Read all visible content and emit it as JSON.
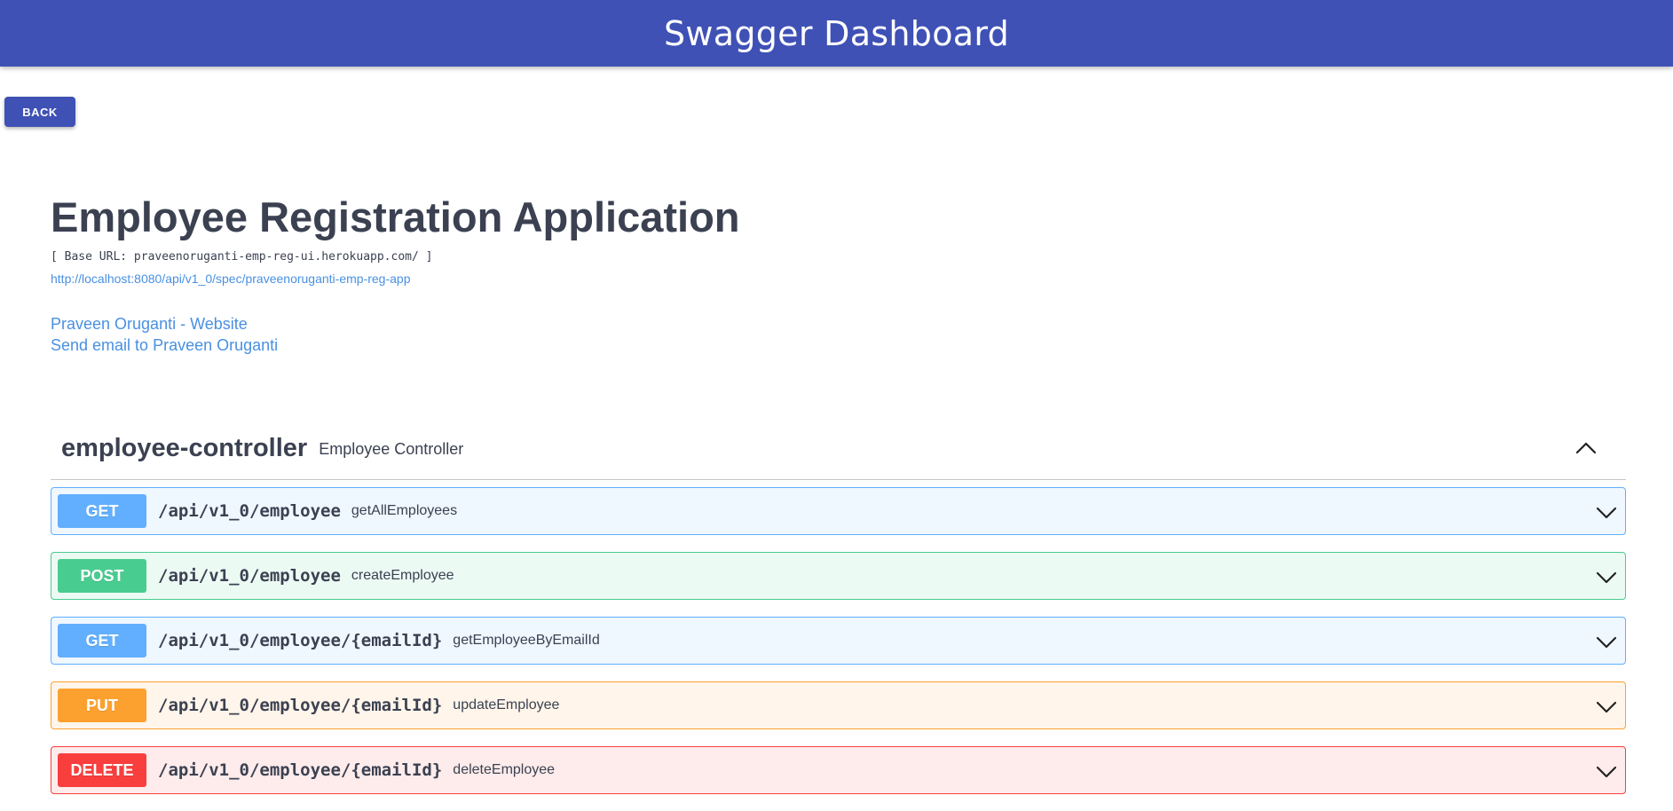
{
  "header": {
    "title": "Swagger Dashboard"
  },
  "back_button": {
    "label": "BACK"
  },
  "info": {
    "title": "Employee Registration Application",
    "base_url": "[ Base URL: praveenoruganti-emp-reg-ui.herokuapp.com/ ]",
    "spec_link": "http://localhost:8080/api/v1_0/spec/praveenoruganti-emp-reg-app",
    "website_link": "Praveen Oruganti - Website",
    "email_link": "Send email to Praveen Oruganti"
  },
  "tag": {
    "name": "employee-controller",
    "description": "Employee Controller",
    "toggle_icon": "chevron-up-icon"
  },
  "operations": [
    {
      "method": "GET",
      "path": "/api/v1_0/employee",
      "summary": "getAllEmployees",
      "color": "#61affe"
    },
    {
      "method": "POST",
      "path": "/api/v1_0/employee",
      "summary": "createEmployee",
      "color": "#49cc90"
    },
    {
      "method": "GET",
      "path": "/api/v1_0/employee/{emailId}",
      "summary": "getEmployeeByEmailId",
      "color": "#61affe"
    },
    {
      "method": "PUT",
      "path": "/api/v1_0/employee/{emailId}",
      "summary": "updateEmployee",
      "color": "#fca130"
    },
    {
      "method": "DELETE",
      "path": "/api/v1_0/employee/{emailId}",
      "summary": "deleteEmployee",
      "color": "#f93e3e"
    }
  ],
  "colors": {
    "header_bg": "#3f51b5",
    "text": "#3b4151",
    "link": "#4990e2"
  }
}
